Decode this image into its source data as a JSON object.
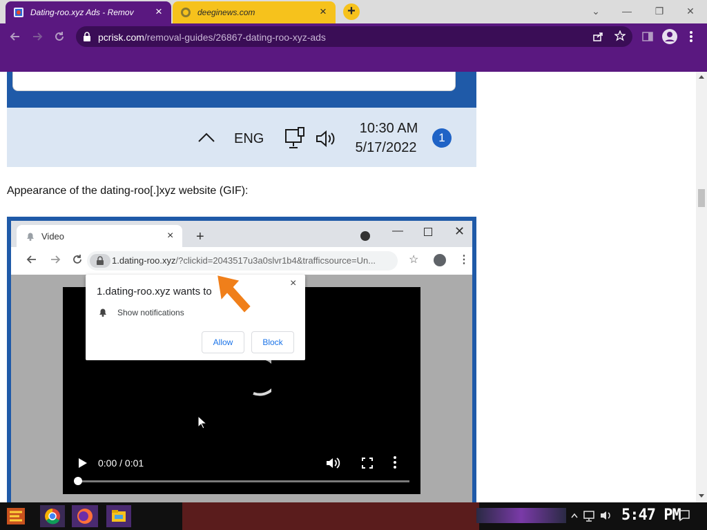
{
  "browser": {
    "tabs": [
      {
        "title": "Dating-roo.xyz Ads - Remov",
        "close": "×"
      },
      {
        "title": "deeginews.com",
        "close": "×"
      }
    ],
    "new_tab": "+",
    "window": {
      "minimize": "⌄",
      "restore": "—",
      "maximize": "❐",
      "close": "✕"
    },
    "url_host": "pcrisk.com",
    "url_path": "/removal-guides/26867-dating-roo-xyz-ads"
  },
  "article": {
    "taskbar_shot": {
      "lang": "ENG",
      "time": "10:30 AM",
      "date": "5/17/2022",
      "badge": "1"
    },
    "caption": "Appearance of the dating-roo[.]xyz website (GIF):",
    "gif": {
      "tab_title": "Video",
      "tab_close": "×",
      "new_tab": "+",
      "url_host": "1.dating-roo.xyz",
      "url_query": "/?clickid=2043517u3a0slvr1b4&trafficsource=Un...",
      "popup_title": "1.dating-roo.xyz wants to",
      "popup_close": "×",
      "permission": "Show notifications",
      "allow": "Allow",
      "block": "Block",
      "video_time": "0:00 / 0:01",
      "video_progress": 0.0
    }
  },
  "taskbar": {
    "clock": "5:47 PM"
  },
  "colors": {
    "accent": "#5a1880",
    "tab2": "#f6c21c",
    "popup_button": "#1a73e8",
    "arrow": "#f07f1a"
  }
}
